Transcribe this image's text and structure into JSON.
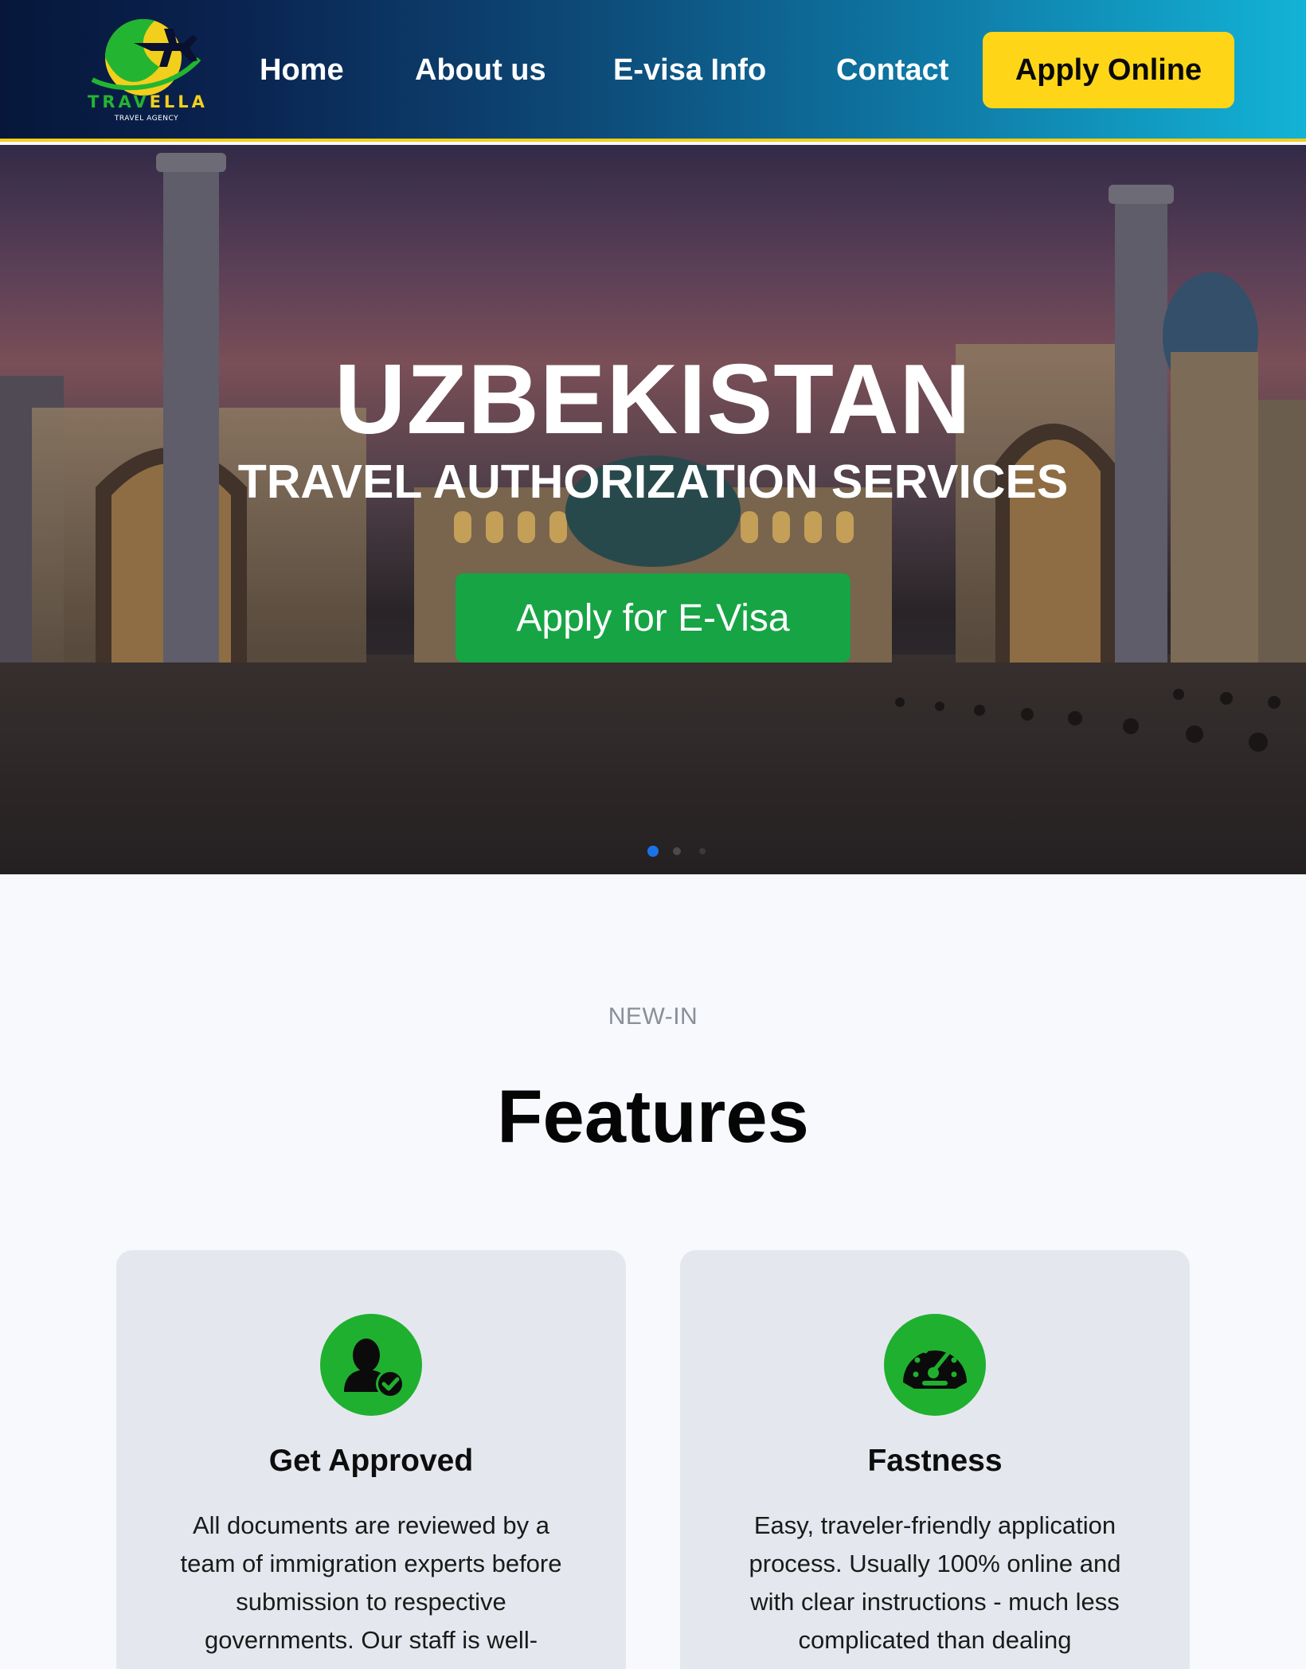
{
  "header": {
    "logo_name": "TRAVELLA",
    "logo_tagline": "TRAVEL AGENCY",
    "nav": [
      "Home",
      "About us",
      "E-visa Info",
      "Contact"
    ],
    "cta_label": "Apply Online",
    "colors": {
      "accent": "#ffd617",
      "border": "#f2cf1c"
    }
  },
  "hero": {
    "title": "UZBEKISTAN",
    "subtitle": "TRAVEL AUTHORIZATION SERVICES",
    "button_label": "Apply for E-Visa",
    "button_color": "#17a444",
    "slides_count": 3,
    "active_slide": 1
  },
  "features": {
    "eyebrow": "NEW-IN",
    "title": "Features",
    "cards": [
      {
        "icon": "user-check-icon",
        "title": "Get Approved",
        "text": "All documents are reviewed by a team of immigration experts before submission to respective governments. Our staff is well-"
      },
      {
        "icon": "speedometer-icon",
        "title": "Fastness",
        "text": "Easy, traveler-friendly application process. Usually 100% online and with clear instructions - much less complicated than dealing"
      }
    ]
  }
}
